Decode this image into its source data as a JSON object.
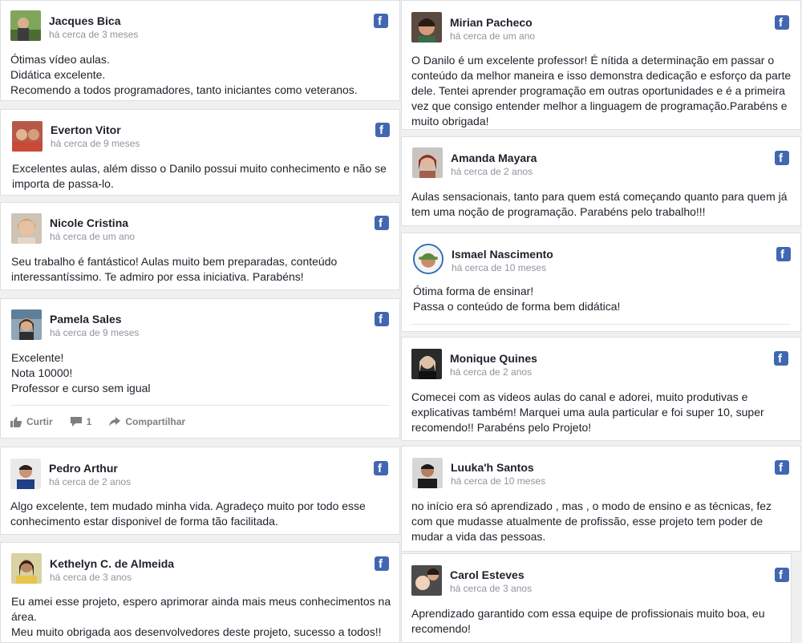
{
  "reviews": [
    {
      "name": "Jacques Bica",
      "time": "há cerca de 3 meses",
      "lines": [
        "Ótimas vídeo aulas.",
        "Didática excelente.",
        "Recomendo a todos programadores, tanto iniciantes como veteranos."
      ]
    },
    {
      "name": "Mirian Pacheco",
      "time": "há cerca de um ano",
      "lines": [
        "O Danilo é um excelente professor! É nítida a determinação em passar o",
        "conteúdo da melhor maneira e isso demonstra dedicação e esforço da parte",
        "dele. Tentei aprender programação em outras oportunidades e é a primeira",
        "vez que consigo entender melhor a linguagem de programação.Parabéns e",
        "muito obrigada!"
      ]
    },
    {
      "name": "Everton Vitor",
      "time": "há cerca de 9 meses",
      "lines": [
        "Excelentes aulas, além disso o Danilo possui muito conhecimento e não se",
        "importa de passa-lo."
      ]
    },
    {
      "name": "Amanda Mayara",
      "time": "há cerca de 2 anos",
      "lines": [
        "Aulas sensacionais, tanto para quem está começando quanto para quem já",
        "tem uma noção de programação. Parabéns pelo trabalho!!!"
      ]
    },
    {
      "name": "Nicole Cristina",
      "time": "há cerca de um ano",
      "lines": [
        "Seu trabalho é fantástico! Aulas muito bem preparadas, conteúdo",
        "interessantíssimo. Te admiro por essa iniciativa. Parabéns!"
      ]
    },
    {
      "name": "Ismael Nascimento",
      "time": "há cerca de 10 meses",
      "lines": [
        "Ótima forma de ensinar!",
        "Passa o conteúdo de forma bem didática!"
      ]
    },
    {
      "name": "Pamela Sales",
      "time": "há cerca de 9 meses",
      "lines": [
        "Excelente!",
        "Nota 10000!",
        "Professor e curso sem igual"
      ]
    },
    {
      "name": "Monique Quines",
      "time": "há cerca de 2 anos",
      "lines": [
        "Comecei com as videos aulas do canal e adorei, muito produtivas e",
        "explicativas também! Marquei uma aula particular e foi super 10, super",
        "recomendo!! Parabéns pelo Projeto!"
      ]
    },
    {
      "name": "Pedro Arthur",
      "time": "há cerca de 2 anos",
      "lines": [
        "Algo excelente, tem mudado minha vida. Agradeço muito por todo esse",
        "conhecimento estar disponivel de forma tão facilitada."
      ]
    },
    {
      "name": "Luuka'h Santos",
      "time": "há cerca de 10 meses",
      "lines": [
        "no início era só aprendizado , mas , o modo de ensino e as técnicas, fez",
        "com que mudasse atualmente de profissão, esse projeto tem poder de",
        "mudar a vida das pessoas."
      ]
    },
    {
      "name": "Kethelyn C. de Almeida",
      "time": "há cerca de 3 anos",
      "lines": [
        "Eu amei esse projeto, espero aprimorar ainda mais meus conhecimentos na",
        "área.",
        "Meu muito obrigada aos desenvolvedores deste projeto, sucesso a todos!!"
      ]
    },
    {
      "name": "Carol Esteves",
      "time": "há cerca de 3 anos",
      "lines": [
        "Aprendizado garantido com essa equipe de profissionais muito boa, eu",
        "recomendo!"
      ]
    }
  ],
  "pamela_actions": {
    "like": "Curtir",
    "comments": "1",
    "share": "Compartilhar"
  },
  "icons": {
    "network": "facebook-icon",
    "like": "thumbs-up-icon",
    "comment": "comment-icon",
    "share": "share-arrow-icon"
  },
  "colors": {
    "facebook": "#4267b2",
    "name": "#1d2129",
    "timestamp": "#90949c"
  }
}
